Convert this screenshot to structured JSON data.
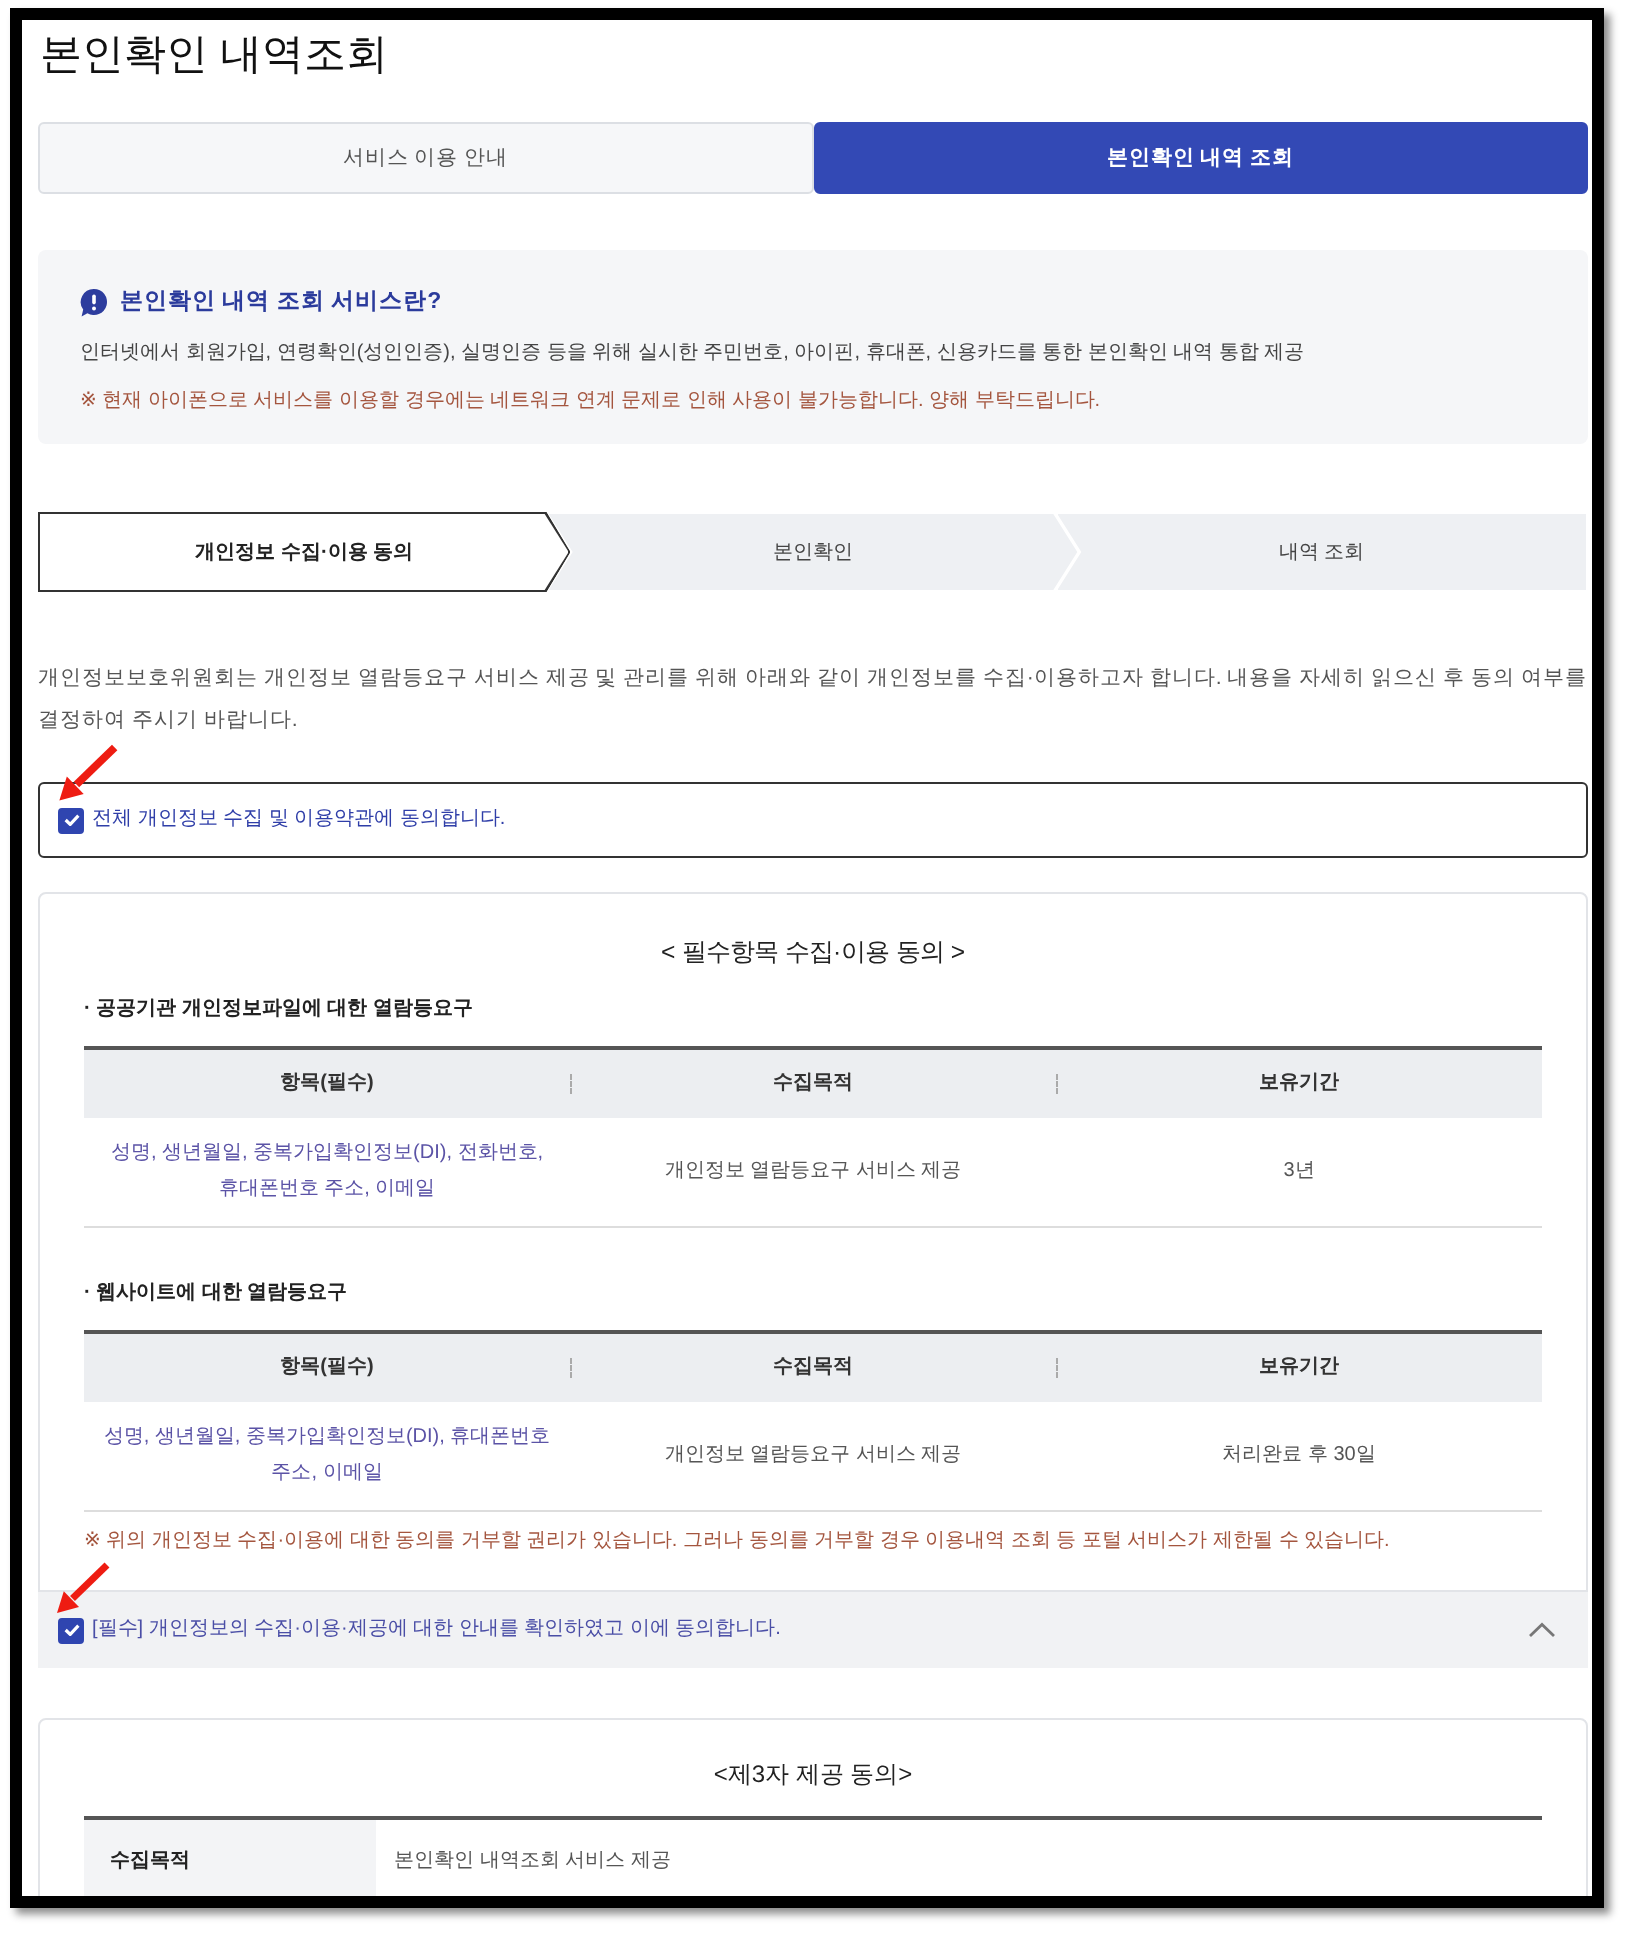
{
  "page": {
    "title": "본인확인 내역조회"
  },
  "tabs": [
    {
      "label": "서비스 이용 안내",
      "selected": false
    },
    {
      "label": "본인확인 내역 조회",
      "selected": true
    }
  ],
  "info": {
    "heading": "본인확인 내역 조회 서비스란?",
    "description": "인터넷에서 회원가입, 연령확인(성인인증), 실명인증 등을 위해 실시한 주민번호, 아이핀, 휴대폰, 신용카드를 통한 본인확인 내역 통합 제공",
    "notice": "※ 현재 아이폰으로 서비스를 이용할 경우에는 네트워크 연계 문제로 인해 사용이 불가능합니다. 양해 부탁드립니다."
  },
  "steps": [
    {
      "label": "개인정보 수집·이용 동의",
      "selected": true
    },
    {
      "label": "본인확인",
      "selected": false
    },
    {
      "label": "내역 조회",
      "selected": false
    }
  ],
  "intro": "개인정보보호위원회는 개인정보 열람등요구 서비스 제공 및 관리를 위해 아래와 같이 개인정보를 수집·이용하고자 합니다. 내용을 자세히 읽으신 후 동의 여부를 결정하여 주시기 바랍니다.",
  "agree_all": {
    "label": "전체 개인정보 수집 및 이용약관에 동의합니다.",
    "checked": true
  },
  "required_consent": {
    "title": "< 필수항목 수집·이용 동의 >",
    "sections": [
      {
        "heading": "· 공공기관 개인정보파일에 대한 열람등요구",
        "columns": [
          "항목(필수)",
          "수집목적",
          "보유기간"
        ],
        "rows": [
          [
            "성명, 생년월일, 중복가입확인정보(DI), 전화번호, 휴대폰번호 주소, 이메일",
            "개인정보 열람등요구 서비스 제공",
            "3년"
          ]
        ]
      },
      {
        "heading": "· 웹사이트에 대한 열람등요구",
        "columns": [
          "항목(필수)",
          "수집목적",
          "보유기간"
        ],
        "rows": [
          [
            "성명, 생년월일, 중복가입확인정보(DI), 휴대폰번호 주소, 이메일",
            "개인정보 열람등요구 서비스 제공",
            "처리완료 후 30일"
          ]
        ]
      }
    ],
    "notice": "※ 위의 개인정보 수집·이용에 대한 동의를 거부할 권리가 있습니다. 그러나 동의를 거부할 경우 이용내역 조회 등 포털 서비스가 제한될 수 있습니다.",
    "agreement": {
      "label": "[필수] 개인정보의 수집·이용·제공에 대한 안내를 확인하였고 이에 동의합니다.",
      "checked": true,
      "expanded": true
    }
  },
  "third_party": {
    "title": "<제3자 제공 동의>",
    "rows": [
      {
        "label": "수집목적",
        "value": "본인확인 내역조회 서비스 제공"
      }
    ]
  }
}
